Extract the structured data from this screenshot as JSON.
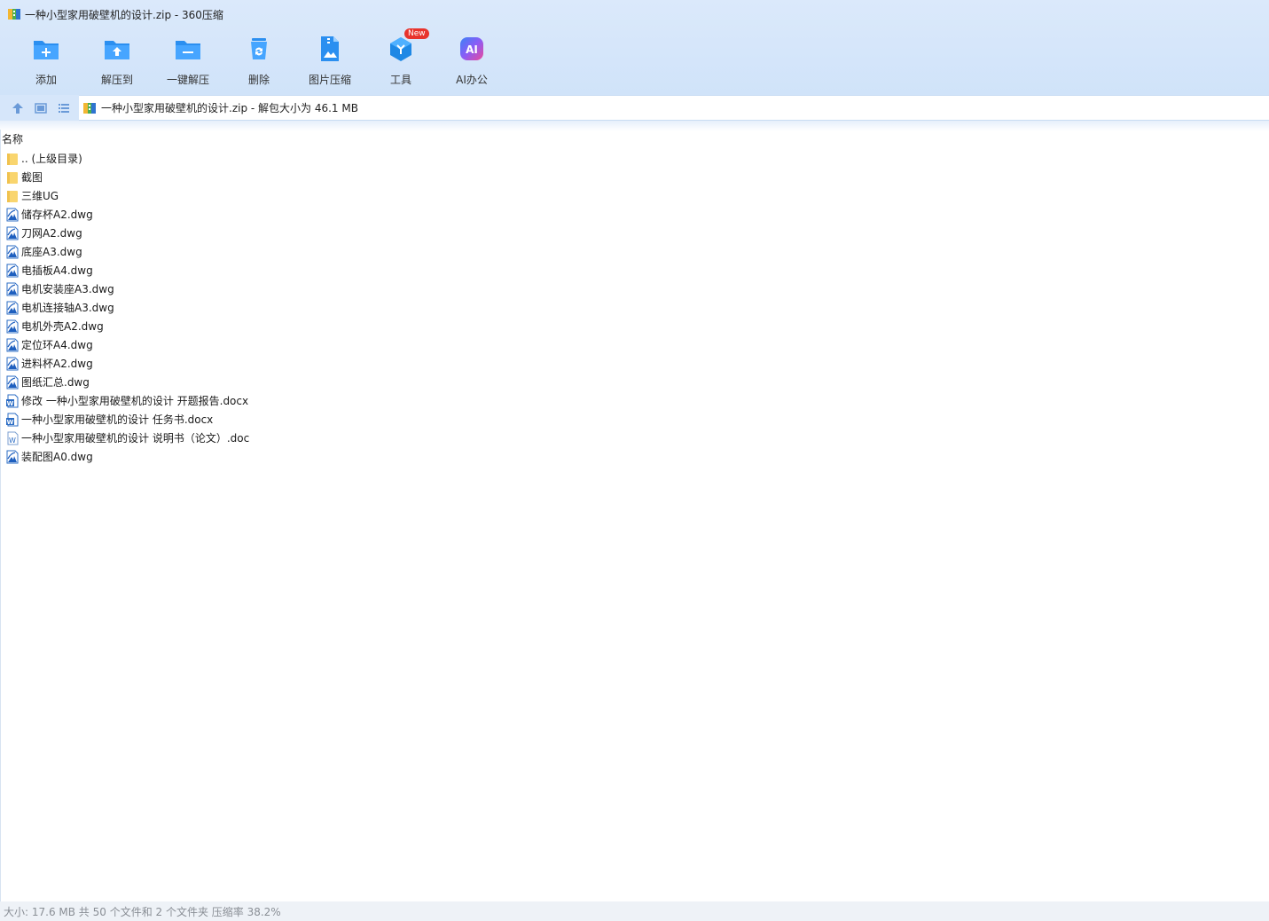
{
  "window": {
    "title": "一种小型家用破壁机的设计.zip - 360压缩"
  },
  "toolbar": {
    "items": [
      {
        "label": "添加",
        "icon": "add-folder-icon"
      },
      {
        "label": "解压到",
        "icon": "extract-to-icon"
      },
      {
        "label": "一键解压",
        "icon": "one-click-extract-icon"
      },
      {
        "label": "删除",
        "icon": "recycle-bin-icon"
      },
      {
        "label": "图片压缩",
        "icon": "image-compress-icon"
      },
      {
        "label": "工具",
        "icon": "tools-cube-icon",
        "badge": "New"
      },
      {
        "label": "AI办公",
        "icon": "ai-office-icon"
      }
    ]
  },
  "addressbar": {
    "path": "一种小型家用破壁机的设计.zip - 解包大小为 46.1 MB"
  },
  "list": {
    "column_name": "名称",
    "rows": [
      {
        "name": ".. (上级目录)",
        "type": "folder"
      },
      {
        "name": "截图",
        "type": "folder"
      },
      {
        "name": "三维UG",
        "type": "folder"
      },
      {
        "name": "储存杯A2.dwg",
        "type": "dwg"
      },
      {
        "name": "刀网A2.dwg",
        "type": "dwg"
      },
      {
        "name": "底座A3.dwg",
        "type": "dwg"
      },
      {
        "name": "电插板A4.dwg",
        "type": "dwg"
      },
      {
        "name": "电机安装座A3.dwg",
        "type": "dwg"
      },
      {
        "name": "电机连接轴A3.dwg",
        "type": "dwg"
      },
      {
        "name": "电机外壳A2.dwg",
        "type": "dwg"
      },
      {
        "name": "定位环A4.dwg",
        "type": "dwg"
      },
      {
        "name": "进料杯A2.dwg",
        "type": "dwg"
      },
      {
        "name": "图纸汇总.dwg",
        "type": "dwg"
      },
      {
        "name": "修改 一种小型家用破壁机的设计 开题报告.docx",
        "type": "docx"
      },
      {
        "name": "一种小型家用破壁机的设计 任务书.docx",
        "type": "docx"
      },
      {
        "name": "一种小型家用破壁机的设计 说明书（论文）.doc",
        "type": "doc"
      },
      {
        "name": "装配图A0.dwg",
        "type": "dwg"
      }
    ]
  },
  "status": {
    "text": "大小: 17.6 MB 共 50 个文件和 2 个文件夹 压缩率 38.2%"
  },
  "colors": {
    "header_bg": "#d4e5fa",
    "accent_blue": "#1e88e5",
    "folder_yellow": "#f9d56e",
    "badge_red": "#e8332c",
    "status_text": "#8a8f96"
  }
}
